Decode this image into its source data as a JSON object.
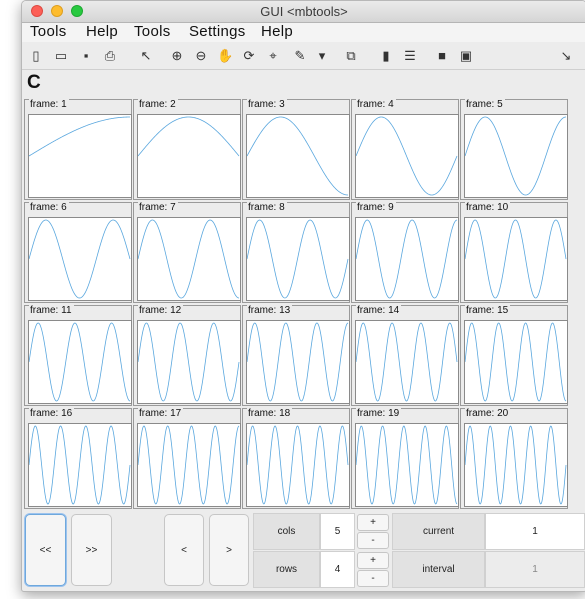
{
  "window": {
    "title": "GUI <mbtools>"
  },
  "menu": [
    "Tools",
    "Help",
    "Tools",
    "Settings",
    "Help"
  ],
  "toolbar": {
    "icons": [
      {
        "name": "new-file-icon",
        "glyph": "▯"
      },
      {
        "name": "open-folder-icon",
        "glyph": "▭"
      },
      {
        "name": "save-icon",
        "glyph": "▪"
      },
      {
        "name": "print-icon",
        "glyph": "⎙"
      },
      {
        "name": "pointer-icon",
        "glyph": "↖"
      },
      {
        "name": "zoom-in-icon",
        "glyph": "⊕"
      },
      {
        "name": "zoom-out-icon",
        "glyph": "⊖"
      },
      {
        "name": "pan-hand-icon",
        "glyph": "✋"
      },
      {
        "name": "rotate-3d-icon",
        "glyph": "⟳"
      },
      {
        "name": "data-cursor-icon",
        "glyph": "⌖"
      },
      {
        "name": "brush-icon",
        "glyph": "✎"
      },
      {
        "name": "brush-dropdown-icon",
        "glyph": "▾"
      },
      {
        "name": "link-plot-icon",
        "glyph": "⧉"
      },
      {
        "name": "colorbar-icon",
        "glyph": "▮"
      },
      {
        "name": "legend-icon",
        "glyph": "☰"
      },
      {
        "name": "hide-plot-tools-icon",
        "glyph": "■"
      },
      {
        "name": "show-plot-tools-icon",
        "glyph": "▣"
      },
      {
        "name": "expand-toolbar-icon",
        "glyph": "↘"
      }
    ],
    "refresh_icon": "refresh-icon",
    "refresh_glyph": "C"
  },
  "frames": [
    {
      "label": "frame: 1",
      "freq": 1
    },
    {
      "label": "frame: 2",
      "freq": 2
    },
    {
      "label": "frame: 3",
      "freq": 3
    },
    {
      "label": "frame: 4",
      "freq": 4
    },
    {
      "label": "frame: 5",
      "freq": 5
    },
    {
      "label": "frame: 6",
      "freq": 6
    },
    {
      "label": "frame: 7",
      "freq": 7
    },
    {
      "label": "frame: 8",
      "freq": 8
    },
    {
      "label": "frame: 9",
      "freq": 9
    },
    {
      "label": "frame: 10",
      "freq": 10
    },
    {
      "label": "frame: 11",
      "freq": 11
    },
    {
      "label": "frame: 12",
      "freq": 12
    },
    {
      "label": "frame: 13",
      "freq": 13
    },
    {
      "label": "frame: 14",
      "freq": 14
    },
    {
      "label": "frame: 15",
      "freq": 15
    },
    {
      "label": "frame: 16",
      "freq": 16
    },
    {
      "label": "frame: 17",
      "freq": 17
    },
    {
      "label": "frame: 18",
      "freq": 18
    },
    {
      "label": "frame: 19",
      "freq": 19
    },
    {
      "label": "frame: 20",
      "freq": 20
    }
  ],
  "controls": {
    "first": "<<",
    "last": ">>",
    "prev": "<",
    "next": ">",
    "cols_label": "cols",
    "cols_value": "5",
    "rows_label": "rows",
    "rows_value": "4",
    "plus": "+",
    "minus": "-",
    "current_label": "current",
    "current_value": "1",
    "interval_label": "interval",
    "interval_value": "1"
  },
  "colors": {
    "curve": "#5aa7de"
  }
}
